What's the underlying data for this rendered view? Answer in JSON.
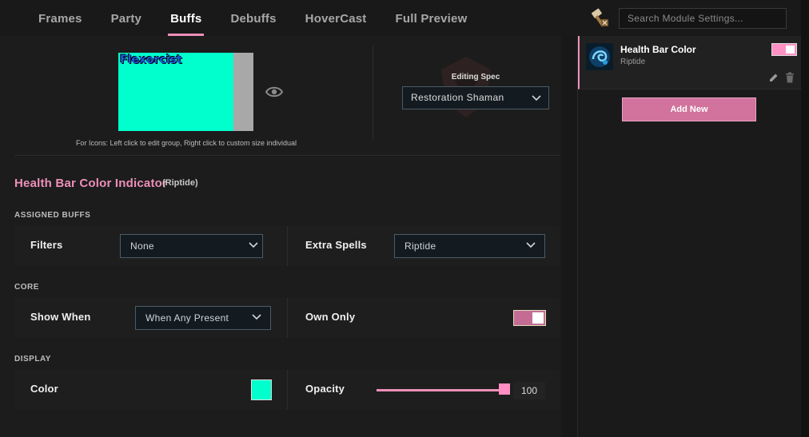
{
  "nav": {
    "tabs": [
      {
        "label": "Frames"
      },
      {
        "label": "Party"
      },
      {
        "label": "Buffs"
      },
      {
        "label": "Debuffs"
      },
      {
        "label": "HoverCast"
      },
      {
        "label": "Full Preview"
      }
    ],
    "active_tab": "Buffs",
    "search": {
      "placeholder": "Search Module Settings...",
      "value": ""
    },
    "settings_icon": "hammer-icon"
  },
  "preview": {
    "frame_name": "Flexorcist",
    "frame_color": "#00ffcc",
    "hint": "For Icons: Left click to edit group, Right click to custom size individual",
    "editing_spec_label": "Editing Spec",
    "editing_spec_value": "Restoration Shaman"
  },
  "indicator": {
    "title": "Health Bar Color Indicator",
    "subtitle": "(Riptide)"
  },
  "groups": {
    "assigned_buffs": {
      "label": "ASSIGNED BUFFS",
      "filters_label": "Filters",
      "filters_value": "None",
      "extra_spells_label": "Extra Spells",
      "extra_spells_value": "Riptide"
    },
    "core": {
      "label": "CORE",
      "show_when_label": "Show When",
      "show_when_value": "When Any Present",
      "own_only_label": "Own Only",
      "own_only_enabled": true
    },
    "display": {
      "label": "DISPLAY",
      "color_label": "Color",
      "color_value": "#00ffcc",
      "opacity_label": "Opacity",
      "opacity_value": "100"
    }
  },
  "modules": {
    "items": [
      {
        "title": "Health Bar Color",
        "subtitle": "Riptide",
        "enabled": true,
        "icon": "riptide-spell-icon"
      }
    ],
    "add_label": "Add New"
  },
  "colors": {
    "accent": "#ee8fb8",
    "background": "#181818"
  }
}
